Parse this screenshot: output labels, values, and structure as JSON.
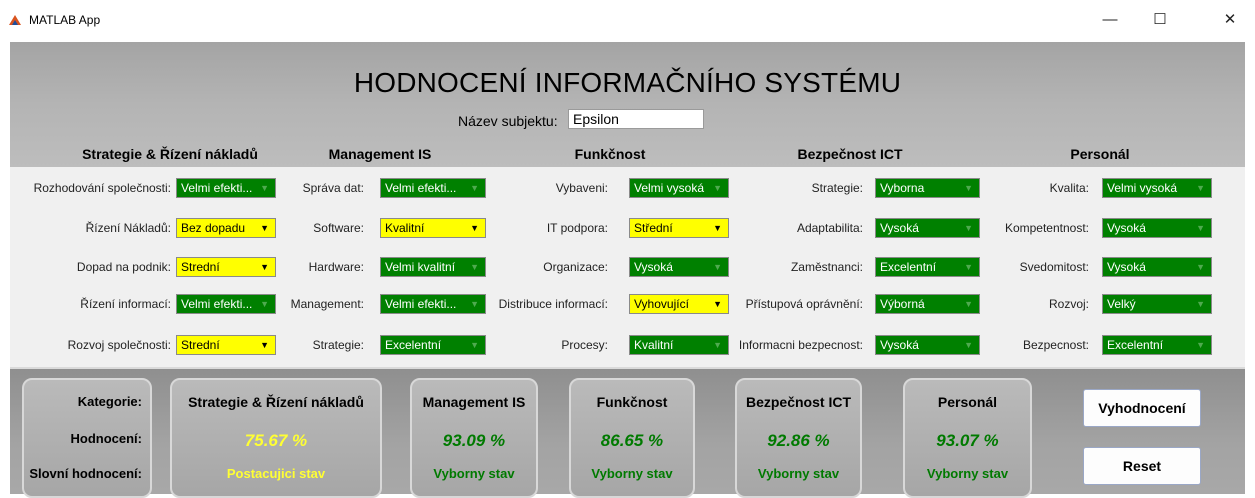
{
  "window": {
    "title": "MATLAB App",
    "controls": {
      "minimize": "—",
      "maximize": "☐",
      "close": "✕"
    }
  },
  "header": {
    "title": "HODNOCENÍ INFORMAČNÍHO SYSTÉMU",
    "subject_label": "Název subjektu:",
    "subject_value": "Epsilon"
  },
  "categories": [
    {
      "title": "Strategie & Řízení nákladů",
      "rows": [
        {
          "label": "Rozhodování společnosti:",
          "value": "Velmi efekti...",
          "color": "green"
        },
        {
          "label": "Řízení Nákladů:",
          "value": "Bez dopadu",
          "color": "yellow"
        },
        {
          "label": "Dopad na podnik:",
          "value": "Strední",
          "color": "yellow"
        },
        {
          "label": "Řízení informací:",
          "value": "Velmi efekti...",
          "color": "green"
        },
        {
          "label": "Rozvoj společnosti:",
          "value": "Strední",
          "color": "yellow"
        }
      ]
    },
    {
      "title": "Management IS",
      "rows": [
        {
          "label": "Správa dat:",
          "value": "Velmi efekti...",
          "color": "green"
        },
        {
          "label": "Software:",
          "value": "Kvalitní",
          "color": "yellow"
        },
        {
          "label": "Hardware:",
          "value": "Velmi kvalitní",
          "color": "green"
        },
        {
          "label": "Management:",
          "value": "Velmi efekti...",
          "color": "green"
        },
        {
          "label": "Strategie:",
          "value": "Excelentní",
          "color": "green"
        }
      ]
    },
    {
      "title": "Funkčnost",
      "rows": [
        {
          "label": "Vybaveni:",
          "value": "Velmi vysoká",
          "color": "green"
        },
        {
          "label": "IT podpora:",
          "value": "Střední",
          "color": "yellow"
        },
        {
          "label": "Organizace:",
          "value": "Vysoká",
          "color": "green"
        },
        {
          "label": "Distribuce informací:",
          "value": "Vyhovující",
          "color": "yellow"
        },
        {
          "label": "Procesy:",
          "value": "Kvalitní",
          "color": "green"
        }
      ]
    },
    {
      "title": "Bezpečnost ICT",
      "rows": [
        {
          "label": "Strategie:",
          "value": "Vyborna",
          "color": "green"
        },
        {
          "label": "Adaptabilita:",
          "value": "Vysoká",
          "color": "green"
        },
        {
          "label": "Zaměstnanci:",
          "value": "Excelentní",
          "color": "green"
        },
        {
          "label": "Přístupová oprávnění:",
          "value": "Výborná",
          "color": "green"
        },
        {
          "label": "Informacni bezpecnost:",
          "value": "Vysoká",
          "color": "green"
        }
      ]
    },
    {
      "title": "Personál",
      "rows": [
        {
          "label": "Kvalita:",
          "value": "Velmi vysoká",
          "color": "green"
        },
        {
          "label": "Kompetentnost:",
          "value": "Vysoká",
          "color": "green"
        },
        {
          "label": "Svedomitost:",
          "value": "Vysoká",
          "color": "green"
        },
        {
          "label": "Rozvoj:",
          "value": "Velký",
          "color": "green"
        },
        {
          "label": "Bezpecnost:",
          "value": "Excelentní",
          "color": "green"
        }
      ]
    }
  ],
  "results": {
    "labels": {
      "category": "Kategorie:",
      "score": "Hodnocení:",
      "verbal": "Slovní hodnocení:"
    },
    "cards": [
      {
        "title": "Strategie & Řízení nákladů",
        "score": "75.67 %",
        "verbal": "Postacujici stav",
        "color": "#ffff33"
      },
      {
        "title": "Management IS",
        "score": "93.09 %",
        "verbal": "Vyborny stav",
        "color": "#007a00"
      },
      {
        "title": "Funkčnost",
        "score": "86.65 %",
        "verbal": "Vyborny stav",
        "color": "#007a00"
      },
      {
        "title": "Bezpečnost ICT",
        "score": "92.86 %",
        "verbal": "Vyborny stav",
        "color": "#007a00"
      },
      {
        "title": "Personál",
        "score": "93.07 %",
        "verbal": "Vyborny stav",
        "color": "#007a00"
      }
    ]
  },
  "buttons": {
    "evaluate": "Vyhodnocení",
    "reset": "Reset"
  }
}
